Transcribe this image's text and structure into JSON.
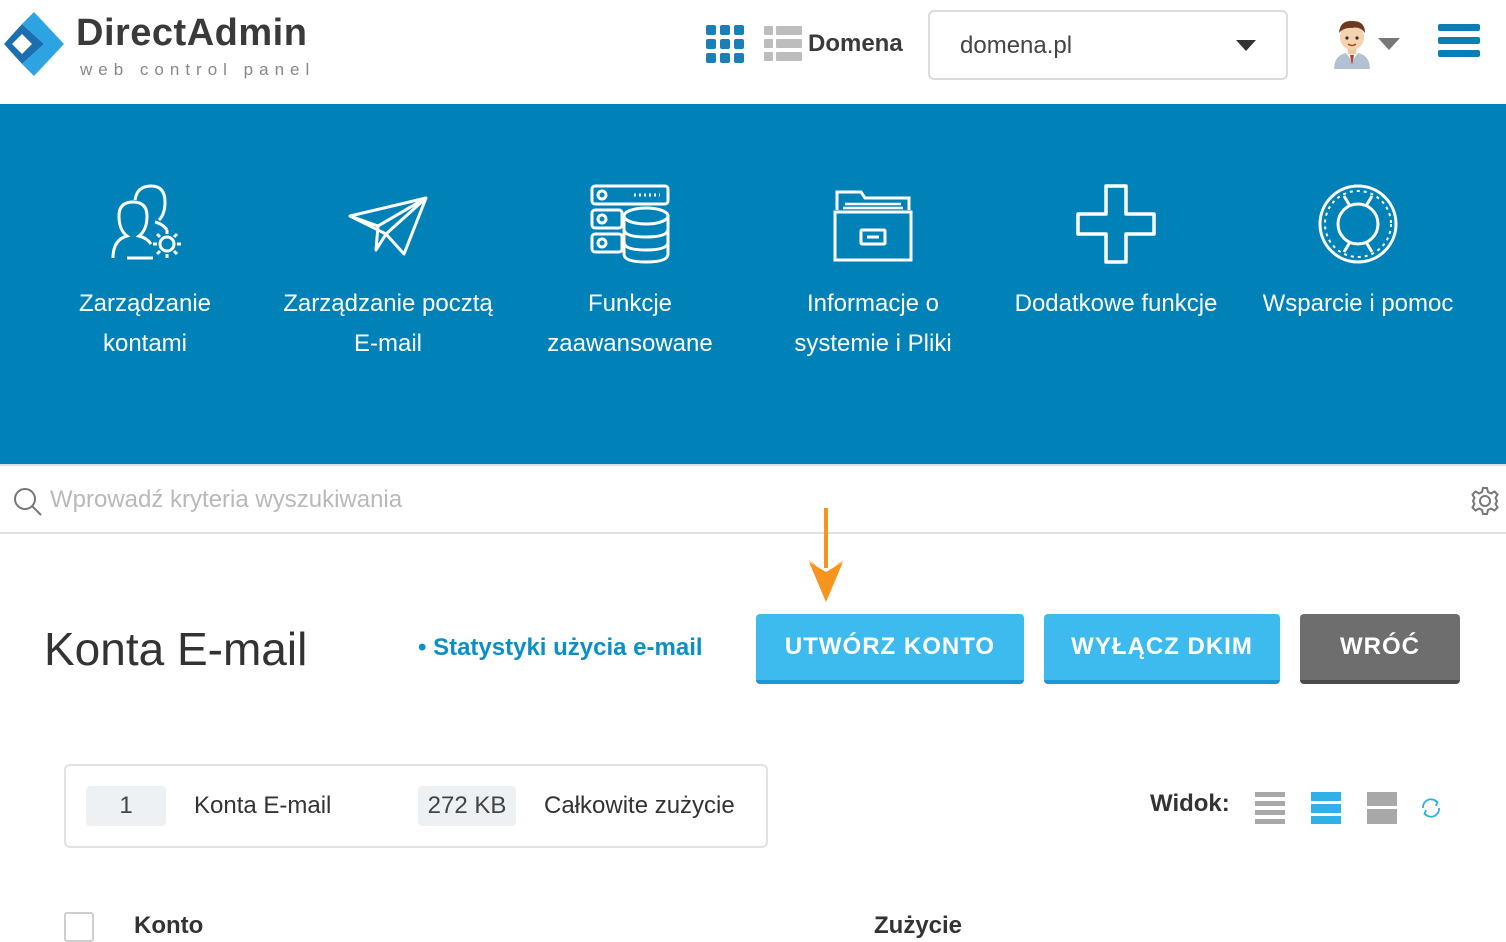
{
  "header": {
    "logo_title": "DirectAdmin",
    "logo_subtitle": "web control panel",
    "domain_label": "Domena",
    "selected_domain": "domena.pl"
  },
  "nav": {
    "items": [
      {
        "label": "Zarządzanie kontami",
        "icon": "users-gear-icon"
      },
      {
        "label": "Zarządzanie pocztą E-mail",
        "icon": "paper-plane-icon"
      },
      {
        "label": "Funkcje zaawansowane",
        "icon": "server-database-icon"
      },
      {
        "label": "Informacje o systemie i Pliki",
        "icon": "file-cabinet-icon"
      },
      {
        "label": "Dodatkowe funkcje",
        "icon": "plus-icon"
      },
      {
        "label": "Wsparcie i pomoc",
        "icon": "lifebuoy-icon"
      }
    ]
  },
  "search": {
    "placeholder": "Wprowadź kryteria wyszukiwania"
  },
  "page": {
    "title": "Konta E-mail",
    "stats_link": "• Statystyki użycia e-mail",
    "buttons": {
      "create": "UTWÓRZ KONTO",
      "dkim": "WYŁĄCZ DKIM",
      "back": "WRÓĆ"
    }
  },
  "summary": {
    "count": "1",
    "count_label": "Konta E-mail",
    "size": "272 KB",
    "size_label": "Całkowite zużycie"
  },
  "view": {
    "label": "Widok:"
  },
  "table": {
    "columns": [
      "Konto",
      "Zużycie"
    ]
  },
  "colors": {
    "nav_background": "#0082b8",
    "accent_button": "#3dbbef",
    "back_button": "#6e6e6e",
    "link": "#0a8fc8",
    "arrow": "#f7941d"
  }
}
